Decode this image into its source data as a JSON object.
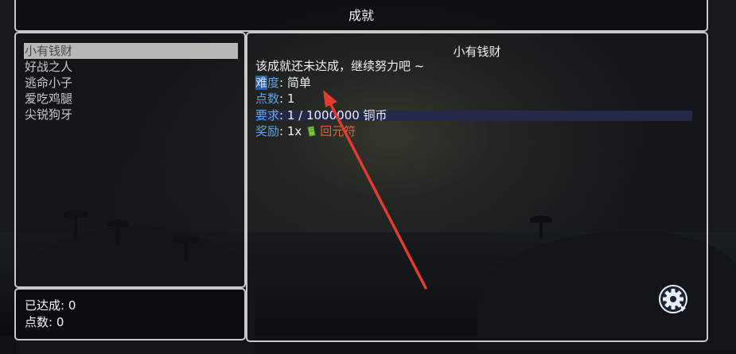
{
  "header": {
    "title": "成就"
  },
  "achievements": {
    "items": [
      {
        "label": "小有钱财"
      },
      {
        "label": "好战之人"
      },
      {
        "label": "逃命小子"
      },
      {
        "label": "爱吃鸡腿"
      },
      {
        "label": "尖锐狗牙"
      }
    ],
    "selected_index": 0
  },
  "stats": {
    "completed": "已达成: 0",
    "points": "点数: 0"
  },
  "detail": {
    "title": "小有钱财",
    "status": "该成就还未达成，继续努力吧 ~",
    "difficulty_label": "难度",
    "difficulty_label_first": "难",
    "difficulty_label_rest": "度",
    "difficulty_value": ": 简单",
    "points_label": "点数",
    "points_value": ": 1",
    "requirement_label": "要求",
    "requirement_value": ": 1 / 1000000 铜币",
    "requirement_progress": 1e-06,
    "reward_label": "奖励",
    "reward_qty": ": 1x",
    "reward_name": "回元符",
    "reward_icon": "green-scroll-icon"
  },
  "colors": {
    "label_blue": "#5fa3e6",
    "reward_orange": "#e0603a",
    "annotation_arrow": "#e53b2f",
    "selected_row": "#b8b8b8"
  },
  "icons": {
    "settings": "gear-icon"
  }
}
